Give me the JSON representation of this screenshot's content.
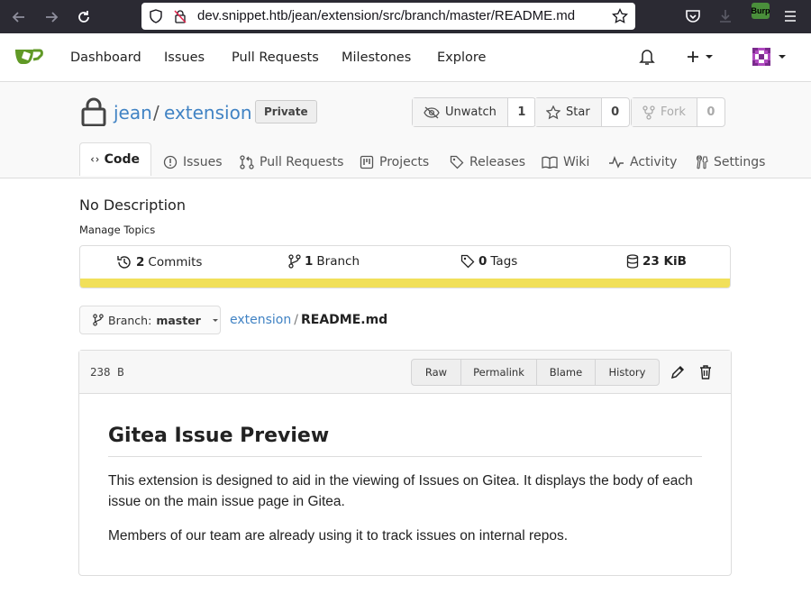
{
  "browser": {
    "url": "dev.snippet.htb/jean/extension/src/branch/master/README.md",
    "burp_label": "Burp"
  },
  "nav": {
    "links": [
      "Dashboard",
      "Issues",
      "Pull Requests",
      "Milestones",
      "Explore"
    ]
  },
  "repo": {
    "owner": "jean",
    "separator": "/",
    "name": "extension",
    "badge": "Private",
    "watch": {
      "label": "Unwatch",
      "count": "1"
    },
    "star": {
      "label": "Star",
      "count": "0"
    },
    "fork": {
      "label": "Fork",
      "count": "0"
    },
    "tabs": [
      "Code",
      "Issues",
      "Pull Requests",
      "Projects",
      "Releases",
      "Wiki",
      "Activity",
      "Settings"
    ]
  },
  "main": {
    "description": "No Description",
    "manage_topics": "Manage Topics",
    "stats": {
      "commits_count": "2",
      "commits_label": "Commits",
      "branches_count": "1",
      "branches_label": "Branch",
      "tags_count": "0",
      "tags_label": "Tags",
      "size": "23 KiB"
    },
    "lang_color": "#f1e05a",
    "branch_prefix": "Branch:",
    "branch_name": "master",
    "breadcrumb_repo": "extension",
    "breadcrumb_sep": "/",
    "breadcrumb_file": "README.md"
  },
  "file": {
    "size": "238 B",
    "buttons": [
      "Raw",
      "Permalink",
      "Blame",
      "History"
    ],
    "readme": {
      "title": "Gitea Issue Preview",
      "paragraph1": "This extension is designed to aid in the viewing of Issues on Gitea. It displays the body of each issue on the main issue page in Gitea.",
      "paragraph2": "Members of our team are already using it to track issues on internal repos."
    }
  },
  "colors": {
    "link": "#4183c4",
    "gitea_green": "#609926"
  }
}
